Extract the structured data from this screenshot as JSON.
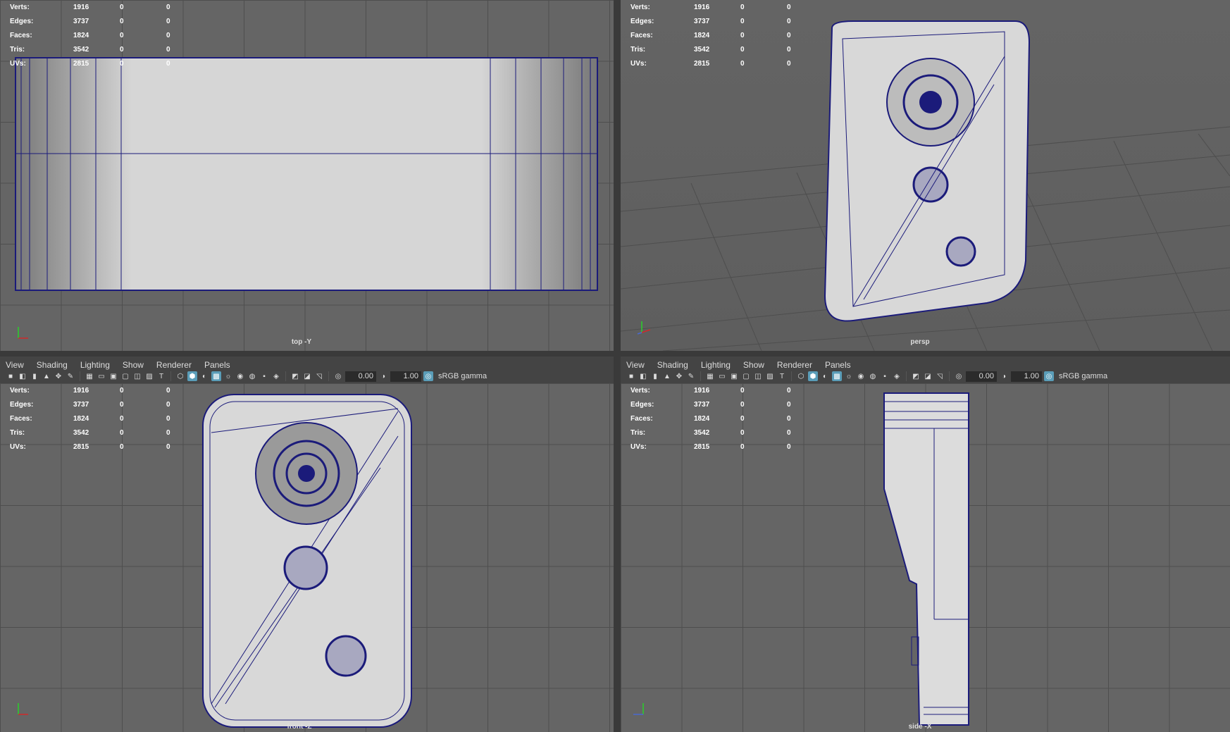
{
  "menu": {
    "view": "View",
    "shading": "Shading",
    "lighting": "Lighting",
    "show": "Show",
    "renderer": "Renderer",
    "panels": "Panels"
  },
  "toolbar": {
    "exposure": "0.00",
    "gamma": "1.00",
    "colorspace": "sRGB gamma"
  },
  "hud": {
    "labels": [
      "Verts:",
      "Edges:",
      "Faces:",
      "Tris:",
      "UVs:"
    ],
    "verts": [
      "1916",
      "0",
      "0"
    ],
    "edges": [
      "3737",
      "0",
      "0"
    ],
    "faces": [
      "1824",
      "0",
      "0"
    ],
    "tris": [
      "3542",
      "0",
      "0"
    ],
    "uvs": [
      "2815",
      "0",
      "0"
    ]
  },
  "cameras": {
    "top": "top -Y",
    "persp": "persp",
    "front": "front -Z",
    "side": "side -X"
  },
  "colors": {
    "viewport_bg": "#656565",
    "grid": "#4e4e4e",
    "wire": "#1b1b7a",
    "active_icon": "#5a9db8"
  },
  "icons": [
    "camera-icon",
    "grid-icon",
    "wireframe-icon",
    "shaded-icon",
    "textured-icon",
    "light-icon",
    "xray-icon",
    "exposure-icon",
    "gamma-icon",
    "colorspace-icon"
  ]
}
